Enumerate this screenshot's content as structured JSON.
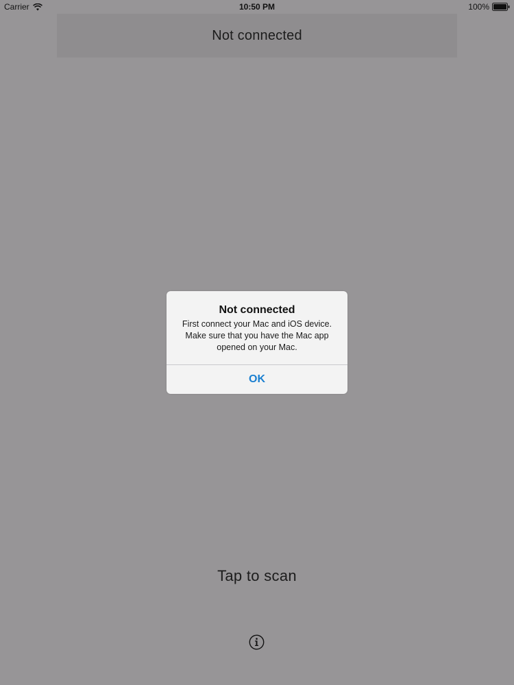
{
  "status_bar": {
    "carrier": "Carrier",
    "time": "10:50 PM",
    "battery_percent": "100%"
  },
  "header": {
    "title": "Not connected"
  },
  "alert": {
    "title": "Not connected",
    "message": "First connect your Mac and iOS device. Make sure that you have the Mac app opened on your Mac.",
    "ok_label": "OK"
  },
  "main": {
    "scan_label": "Tap to scan",
    "info_icon": "info-icon"
  },
  "colors": {
    "background": "#979597",
    "header_panel": "#8f8d8f",
    "alert_background": "#f3f3f3",
    "accent": "#1a7fd0"
  }
}
